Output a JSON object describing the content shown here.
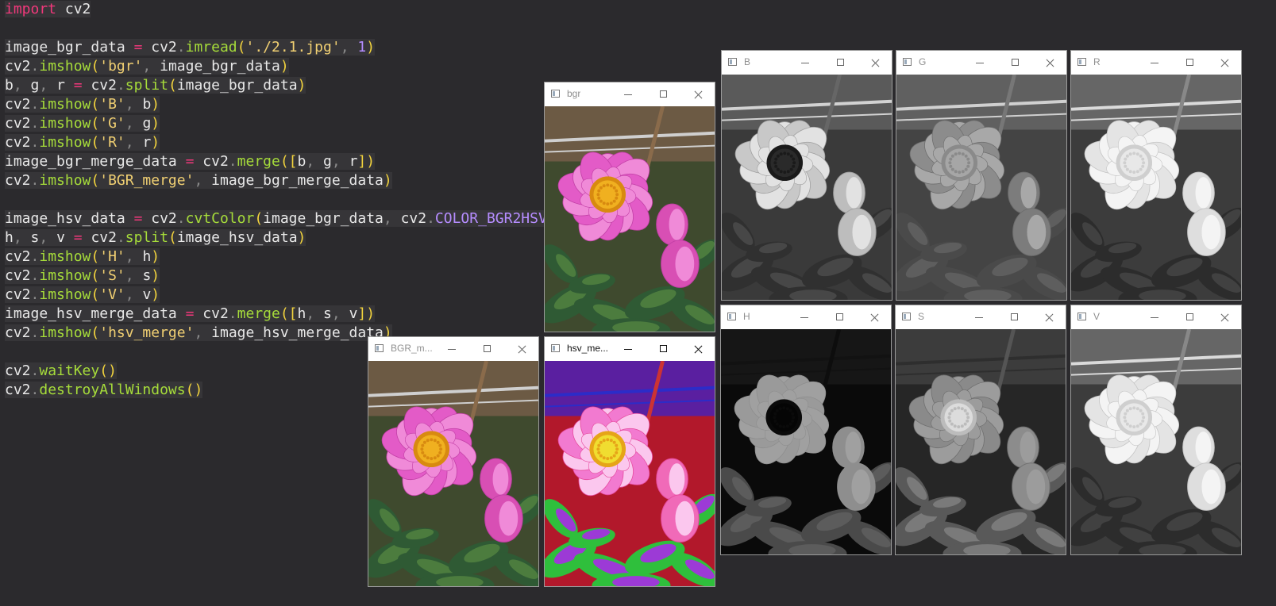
{
  "code": {
    "lines": [
      "import cv2",
      "",
      "image_bgr_data = cv2.imread('./2.1.jpg', 1)",
      "cv2.imshow('bgr', image_bgr_data)",
      "b, g, r = cv2.split(image_bgr_data)",
      "cv2.imshow('B', b)",
      "cv2.imshow('G', g)",
      "cv2.imshow('R', r)",
      "image_bgr_merge_data = cv2.merge([b, g, r])",
      "cv2.imshow('BGR_merge', image_bgr_merge_data)",
      "",
      "image_hsv_data = cv2.cvtColor(image_bgr_data, cv2.COLOR_BGR2HSV)",
      "h, s, v = cv2.split(image_hsv_data)",
      "cv2.imshow('H', h)",
      "cv2.imshow('S', s)",
      "cv2.imshow('V', v)",
      "image_hsv_merge_data = cv2.merge([h, s, v])",
      "cv2.imshow('hsv_merge', image_hsv_merge_data)",
      "",
      "cv2.waitKey()",
      "cv2.destroyAllWindows()"
    ]
  },
  "windows": {
    "bgr": {
      "title": "bgr"
    },
    "B": {
      "title": "B"
    },
    "G": {
      "title": "G"
    },
    "R": {
      "title": "R"
    },
    "H": {
      "title": "H"
    },
    "S": {
      "title": "S"
    },
    "V": {
      "title": "V"
    },
    "bgr_merge": {
      "title": "BGR_m..."
    },
    "hsv_merge": {
      "title": "hsv_me..."
    }
  },
  "colors": {
    "editor_bg": "#2b2a2d",
    "keyword": "#f2387b",
    "function": "#a6dc3a",
    "string": "#f0cf72",
    "number": "#b48cff",
    "petal": "#e35bc7",
    "center": "#f0b020"
  },
  "icons": {
    "window_icon": "app-window-icon",
    "minimize": "minimize-icon",
    "maximize": "maximize-icon",
    "close": "close-icon"
  }
}
